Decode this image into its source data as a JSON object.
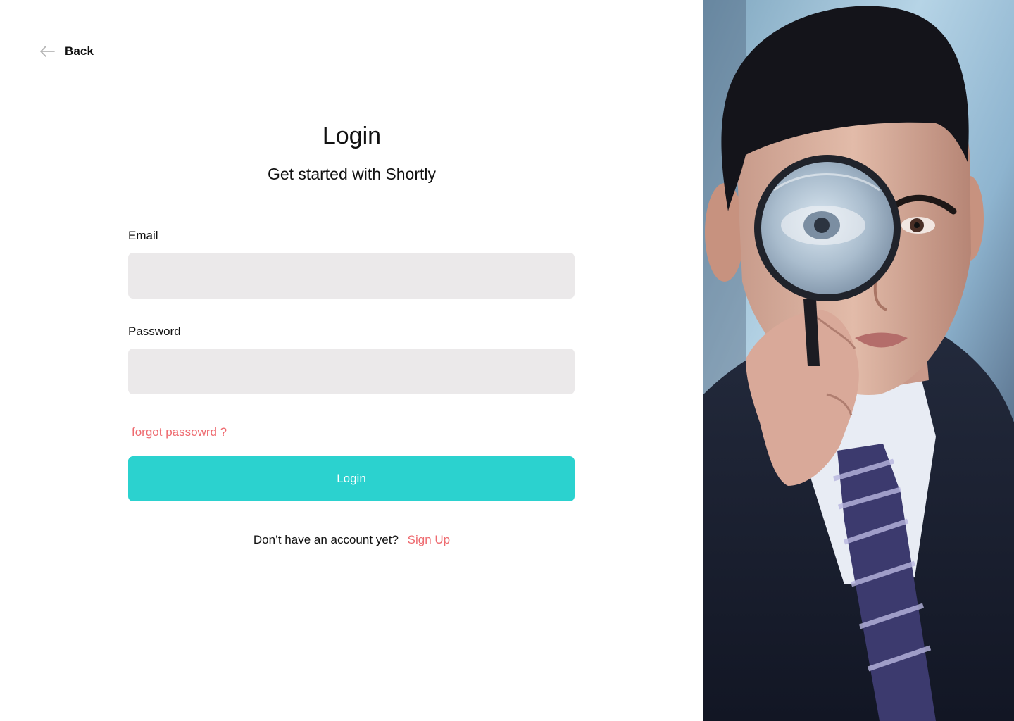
{
  "back": {
    "label": "Back",
    "icon": "arrow-left-icon"
  },
  "header": {
    "title": "Login",
    "subtitle": "Get started with Shortly"
  },
  "form": {
    "email": {
      "label": "Email",
      "value": "",
      "placeholder": ""
    },
    "password": {
      "label": "Password",
      "value": "",
      "placeholder": ""
    },
    "forgot_label": "forgot passowrd ?",
    "submit_label": "Login"
  },
  "signup": {
    "prompt": "Don’t have an account yet?",
    "link_label": "Sign Up"
  },
  "hero_image": {
    "subject": "man-with-magnifying-glass-photo"
  },
  "colors": {
    "accent": "#2bd2cf",
    "link": "#ee6a6f",
    "input_bg": "#ebe9ea",
    "text": "#111111"
  }
}
